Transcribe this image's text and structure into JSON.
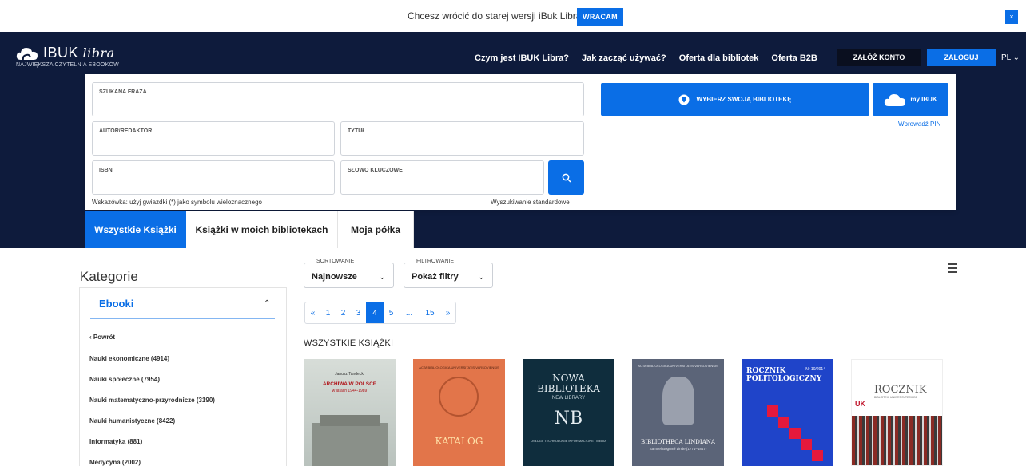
{
  "banner": {
    "text": "Chcesz wrócić do starej wersji iBuk Libra?",
    "button": "WRACAM",
    "close": "×"
  },
  "logo": {
    "main": "IBUK",
    "script": "libra",
    "subtitle": "NAJWIĘKSZA CZYTELNIA EBOOKÓW"
  },
  "nav": {
    "links": [
      "Czym jest IBUK Libra?",
      "Jak zacząć używać?",
      "Oferta dla bibliotek",
      "Oferta B2B"
    ],
    "register": "ZAŁÓŻ KONTO",
    "login": "ZALOGUJ",
    "lang": "PL"
  },
  "search": {
    "phrase_label": "SZUKANA FRAZA",
    "author_label": "AUTOR/REDAKTOR",
    "title_label": "TYTUŁ",
    "isbn_label": "ISBN",
    "keyword_label": "SŁOWO KLUCZOWE",
    "hint": "Wskazówka: użyj gwiazdki (*) jako symbolu wieloznacznego",
    "standard": "Wyszukiwanie standardowe",
    "library_button": "WYBIERZ SWOJĄ BIBLIOTEKĘ",
    "myibuk_button": "my IBUK",
    "pin_link": "Wprowadź PIN"
  },
  "tabs": [
    "Wszystkie Książki",
    "Książki w moich bibliotekach",
    "Moja półka"
  ],
  "sidebar": {
    "title": "Kategorie",
    "section": "Ebooki",
    "back": "Powrót",
    "items": [
      "Nauki ekonomiczne (4914)",
      "Nauki społeczne (7954)",
      "Nauki matematyczno-przyrodnicze (3190)",
      "Nauki humanistyczne (8422)",
      "Informatyka (881)",
      "Medycyna (2002)"
    ]
  },
  "sort": {
    "label": "SORTOWANIE",
    "value": "Najnowsze"
  },
  "filter": {
    "label": "FILTROWANIE",
    "value": "Pokaż filtry"
  },
  "pagination": [
    "«",
    "1",
    "2",
    "3",
    "4",
    "5",
    "...",
    "15",
    "»"
  ],
  "pagination_active": "4",
  "books_heading": "WSZYSTKIE KSIĄŻKI",
  "books": [
    {
      "title": "ARCHIWA W POLSCE",
      "subtitle": "w latach 1944-1989",
      "author": "Janusz Tandecki"
    },
    {
      "title": "KATALOG",
      "top": "ACTA BIBLIOLOGICA UNIVERSITATIS VARSOVIENSIS"
    },
    {
      "title": "NOWA BIBLIOTEKA",
      "subtitle": "NEW LIBRARY",
      "mark": "NB",
      "foot": "USŁUGI, TECHNOLOGIE INFORMACYJNE I MEDIA"
    },
    {
      "title": "BIBLIOTHECA LINDIANA",
      "subtitle": "Samuel Bogumił Linde (1771–1847)",
      "top": "ACTA BIBLIOLOGICA UNIVERSITATIS VARSOVIENSIS"
    },
    {
      "title": "ROCZNIK POLITOLOGICZNY",
      "issue": "Nr 10/2014"
    },
    {
      "title": "ROCZNIK",
      "subtitle": "BIBLIOTEKI UNIWERSYTECKIEJ",
      "mark": "UK"
    }
  ],
  "colors": {
    "accent": "#0a6ee6",
    "navy": "#0e1b3c"
  }
}
